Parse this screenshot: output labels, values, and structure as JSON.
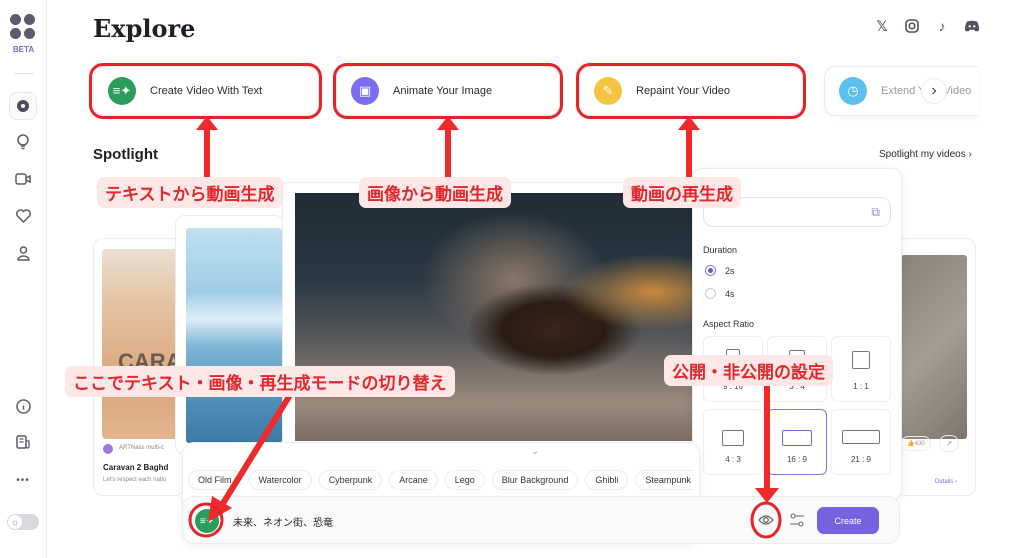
{
  "sidebar": {
    "beta_label": "BETA",
    "more_label": "•••"
  },
  "header": {
    "title": "Explore",
    "social": [
      "X",
      "Instagram",
      "TikTok",
      "Discord"
    ]
  },
  "feature_cards": [
    {
      "label": "Create Video With Text",
      "icon": "text-sparkle-icon",
      "color": "#2a9d5c"
    },
    {
      "label": "Animate Your Image",
      "icon": "image-icon",
      "color": "#7b6cf0"
    },
    {
      "label": "Repaint Your Video",
      "icon": "paintbrush-icon",
      "color": "#f5c542"
    },
    {
      "label": "Extend Your Video",
      "icon": "clock-icon",
      "color": "#5bc0f0"
    }
  ],
  "spotlight": {
    "title": "Spotlight",
    "link": "Spotlight my videos"
  },
  "left_card": {
    "title": "Caravan 2 Baghd",
    "author": "ARTNass multi-c",
    "desc": "Let's respect each natio",
    "poster_text": "CARAV"
  },
  "right_card": {
    "likes": "430",
    "details": "Details"
  },
  "settings": {
    "duration_label": "Duration",
    "durations": [
      "2s",
      "4s"
    ],
    "selected_duration": "2s",
    "aspect_label": "Aspect Ratio",
    "ratios": [
      "9 : 16",
      "3 : 4",
      "1 : 1",
      "4 : 3",
      "16 : 9",
      "21 : 9"
    ],
    "selected_ratio": "16 : 9"
  },
  "styles": [
    "Old Film",
    "Watercolor",
    "Cyberpunk",
    "Arcane",
    "Lego",
    "Blur Background",
    "Ghibli",
    "Steampunk"
  ],
  "prompt": {
    "value": "未来、ネオン街、恐竜",
    "create_label": "Create"
  },
  "annotations": {
    "text_to_video": "テキストから動画生成",
    "image_to_video": "画像から動画生成",
    "repaint": "動画の再生成",
    "mode_switch": "ここでテキスト・画像・再生成モードの切り替え",
    "visibility": "公開・非公開の設定"
  },
  "colors": {
    "accent": "#7462e0",
    "annotation": "#e5242a"
  }
}
